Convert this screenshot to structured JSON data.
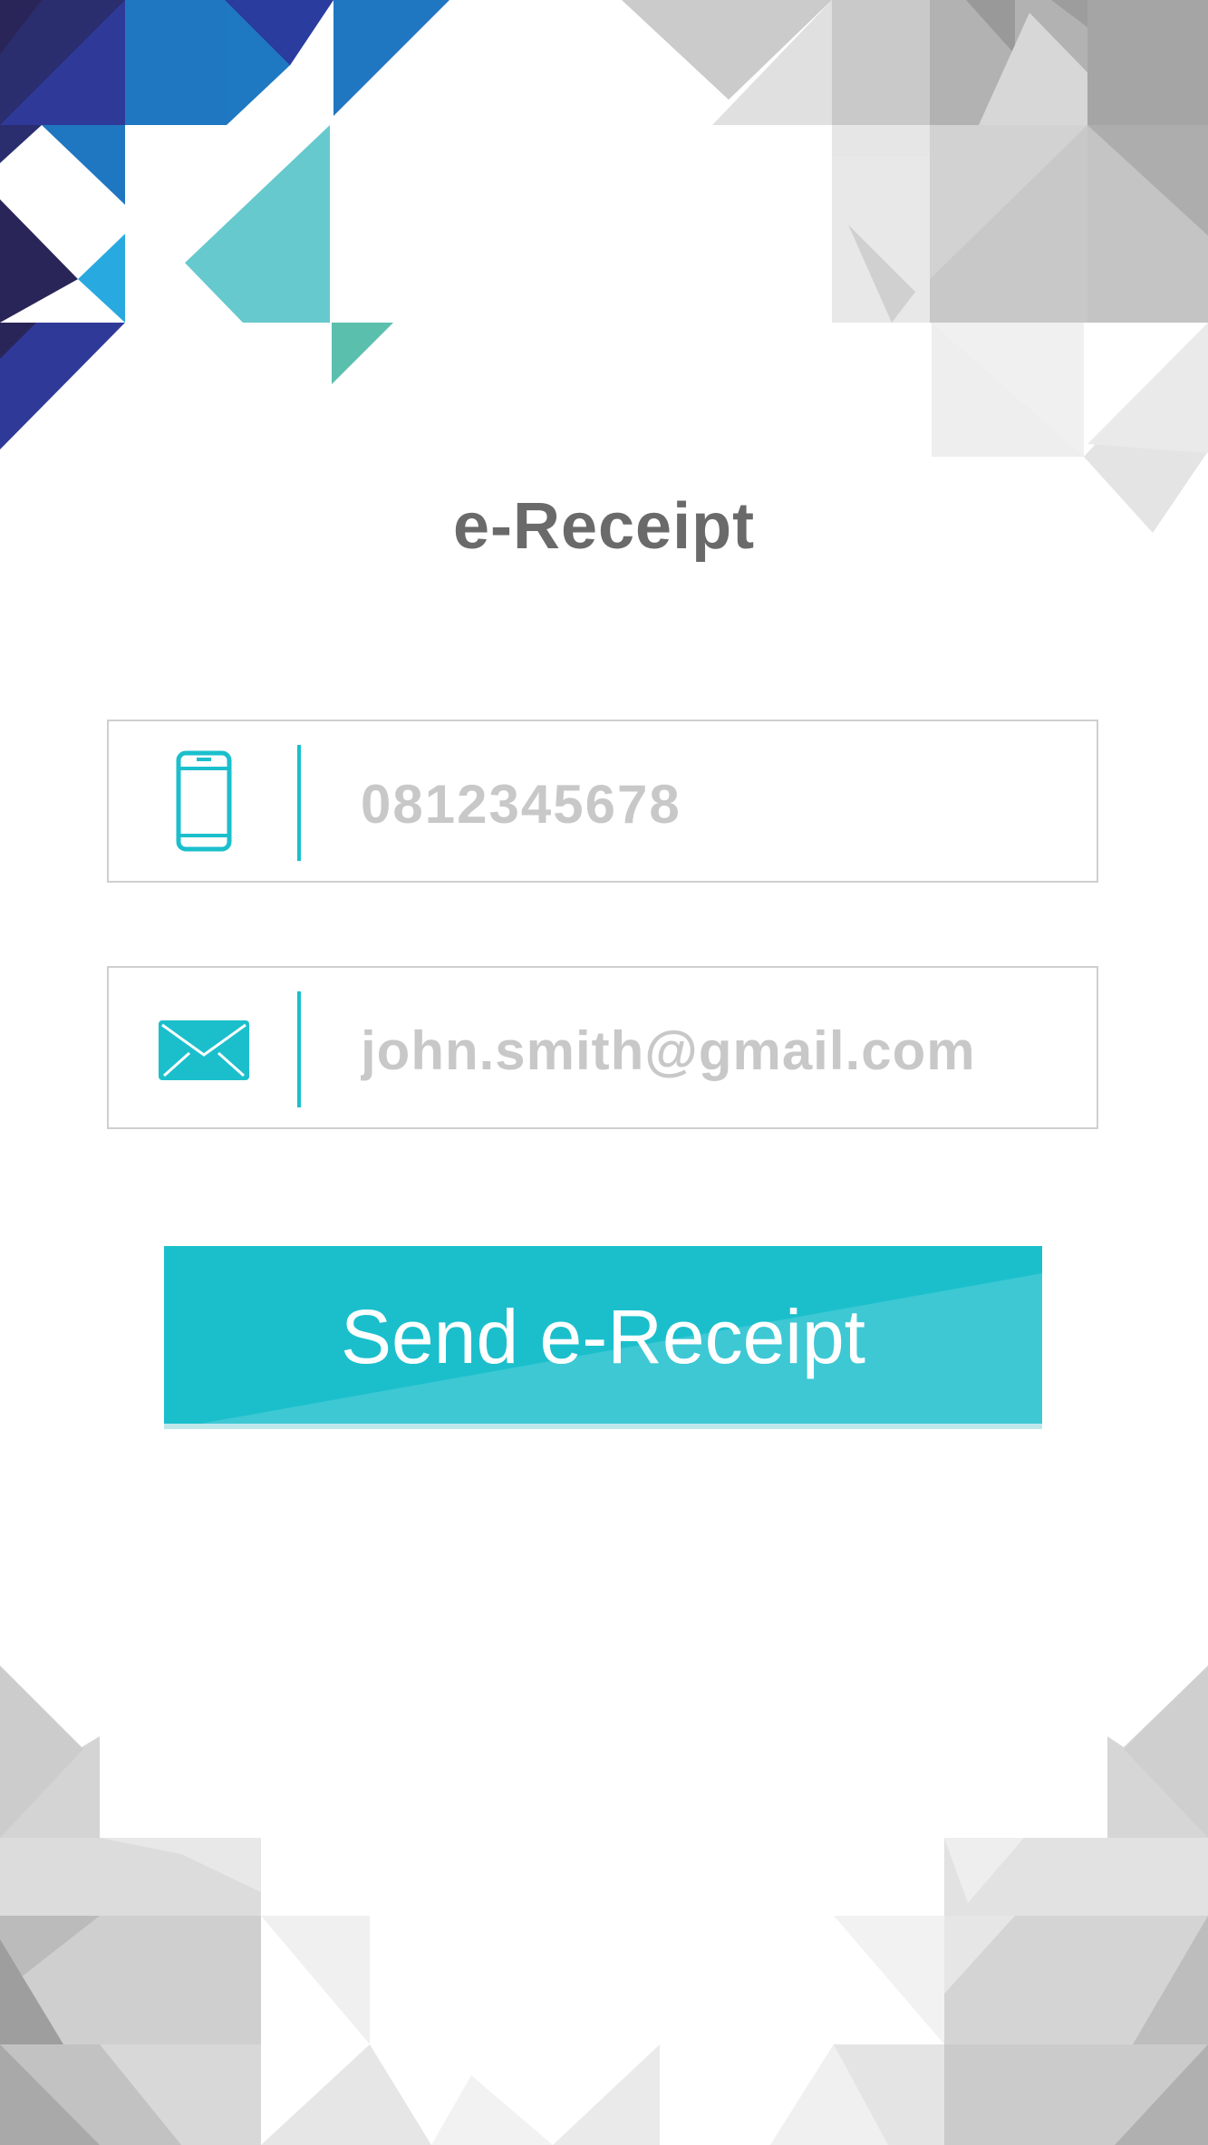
{
  "page": {
    "title": "e-Receipt"
  },
  "phone_field": {
    "placeholder": "0812345678",
    "icon": "mobile-phone-icon"
  },
  "email_field": {
    "placeholder": "john.smith@gmail.com",
    "icon": "envelope-icon"
  },
  "send_button": {
    "label": "Send e-Receipt"
  },
  "colors": {
    "accent": "#1bbfcc",
    "title": "#6a6a6a",
    "placeholder": "#c8c8c8",
    "border": "#cfcfcf"
  }
}
